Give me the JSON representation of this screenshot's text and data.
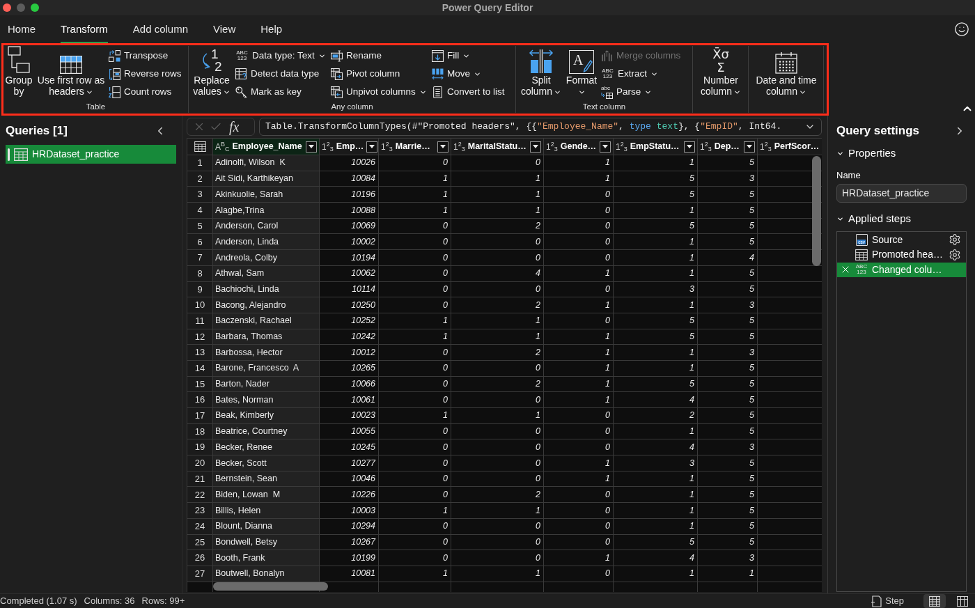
{
  "window": {
    "title": "Power Query Editor"
  },
  "menu_tabs": [
    {
      "label": "Home",
      "selected": false
    },
    {
      "label": "Transform",
      "selected": true
    },
    {
      "label": "Add column",
      "selected": false
    },
    {
      "label": "View",
      "selected": false
    },
    {
      "label": "Help",
      "selected": false
    }
  ],
  "ribbon": {
    "groups": [
      {
        "label": "Table",
        "columns": [
          {
            "kind": "large",
            "lines": [
              "Group",
              "by"
            ],
            "dropdown": false
          },
          {
            "kind": "large",
            "lines": [
              "Use first row as",
              "headers"
            ],
            "dropdown": true
          },
          {
            "kind": "stack",
            "items": [
              {
                "label": "Transpose",
                "dropdown": false,
                "disabled": false
              },
              {
                "label": "Reverse rows",
                "dropdown": false,
                "disabled": false
              },
              {
                "label": "Count rows",
                "dropdown": false,
                "disabled": false
              }
            ]
          }
        ]
      },
      {
        "label": "Any column",
        "columns": [
          {
            "kind": "large",
            "lines": [
              "Replace",
              "values"
            ],
            "dropdown": true,
            "icon_text": [
              "1",
              "2"
            ]
          },
          {
            "kind": "stack",
            "items": [
              {
                "label": "Data type: Text",
                "dropdown": true,
                "disabled": false,
                "icon_text": [
                  "ABC",
                  "123"
                ]
              },
              {
                "label": "Detect data type",
                "dropdown": false,
                "disabled": false
              },
              {
                "label": "Mark as key",
                "dropdown": false,
                "disabled": false
              }
            ]
          },
          {
            "kind": "stack",
            "items": [
              {
                "label": "Rename",
                "dropdown": false,
                "disabled": false
              },
              {
                "label": "Pivot column",
                "dropdown": false,
                "disabled": false
              },
              {
                "label": "Unpivot columns",
                "dropdown": true,
                "disabled": false
              }
            ]
          },
          {
            "kind": "stack",
            "items": [
              {
                "label": "Fill",
                "dropdown": true,
                "disabled": false
              },
              {
                "label": "Move",
                "dropdown": true,
                "disabled": false
              },
              {
                "label": "Convert to list",
                "dropdown": false,
                "disabled": false
              }
            ]
          }
        ]
      },
      {
        "label": "Text column",
        "columns": [
          {
            "kind": "large",
            "lines": [
              "Split",
              "column"
            ],
            "dropdown": true
          },
          {
            "kind": "large",
            "lines": [
              "Format"
            ],
            "dropdown": true,
            "icon_text": [
              "A"
            ]
          },
          {
            "kind": "stack",
            "items": [
              {
                "label": "Merge columns",
                "dropdown": false,
                "disabled": true
              },
              {
                "label": "Extract",
                "dropdown": true,
                "disabled": false,
                "icon_text": [
                  "ABC",
                  "123"
                ]
              },
              {
                "label": "Parse",
                "dropdown": true,
                "disabled": false,
                "icon_text": [
                  "abc"
                ]
              }
            ]
          }
        ]
      },
      {
        "columns": [
          {
            "kind": "large",
            "lines": [
              "Number",
              "column"
            ],
            "dropdown": true,
            "icon_text": [
              "X̄σ",
              "Σ"
            ]
          }
        ]
      },
      {
        "columns": [
          {
            "kind": "large",
            "lines": [
              "Date and time",
              "column"
            ],
            "dropdown": true
          }
        ]
      }
    ]
  },
  "queries": {
    "title": "Queries [1]",
    "items": [
      {
        "name": "HRDataset_practice",
        "selected": true
      }
    ]
  },
  "formula_bar": {
    "fx": "fx",
    "tokens": [
      {
        "text": "Table.TransformColumnTypes(#\"Promoted headers\", {{",
        "kind": "plain"
      },
      {
        "text": "\"Employee_Name\"",
        "kind": "string"
      },
      {
        "text": ", ",
        "kind": "plain"
      },
      {
        "text": "type",
        "kind": "keyword"
      },
      {
        "text": " text",
        "kind": "type"
      },
      {
        "text": "}, {",
        "kind": "plain"
      },
      {
        "text": "\"EmpID\"",
        "kind": "string"
      },
      {
        "text": ", Int64.",
        "kind": "plain"
      }
    ]
  },
  "table": {
    "columns": [
      {
        "name": "Employee_Name",
        "type_label": "A$^{B}$$_{C}$",
        "kind": "text",
        "selected": true
      },
      {
        "name": "Emp…",
        "type_label": "1$^{2}$$_{3}$",
        "kind": "number",
        "selected": false
      },
      {
        "name": "Marrie…",
        "type_label": "1$^{2}$$_{3}$",
        "kind": "number",
        "selected": false
      },
      {
        "name": "MaritalStatu…",
        "type_label": "1$^{2}$$_{3}$",
        "kind": "number",
        "selected": false
      },
      {
        "name": "Gende…",
        "type_label": "1$^{2}$$_{3}$",
        "kind": "number",
        "selected": false
      },
      {
        "name": "EmpStatu…",
        "type_label": "1$^{2}$$_{3}$",
        "kind": "number",
        "selected": false
      },
      {
        "name": "Dep…",
        "type_label": "1$^{2}$$_{3}$",
        "kind": "number",
        "selected": false
      },
      {
        "name": "PerfScor…",
        "type_label": "1$^{2}$$_{3}$",
        "kind": "number",
        "selected": false
      }
    ],
    "rows": [
      {
        "number": "1",
        "cells": [
          "Adinolfi, Wilson  K",
          "10026",
          "0",
          "0",
          "1",
          "1",
          "5"
        ]
      },
      {
        "number": "2",
        "cells": [
          "Ait Sidi, Karthikeyan",
          "10084",
          "1",
          "1",
          "1",
          "5",
          "3"
        ]
      },
      {
        "number": "3",
        "cells": [
          "Akinkuolie, Sarah",
          "10196",
          "1",
          "1",
          "0",
          "5",
          "5"
        ]
      },
      {
        "number": "4",
        "cells": [
          "Alagbe,Trina",
          "10088",
          "1",
          "1",
          "0",
          "1",
          "5"
        ]
      },
      {
        "number": "5",
        "cells": [
          "Anderson, Carol",
          "10069",
          "0",
          "2",
          "0",
          "5",
          "5"
        ]
      },
      {
        "number": "6",
        "cells": [
          "Anderson, Linda",
          "10002",
          "0",
          "0",
          "0",
          "1",
          "5"
        ]
      },
      {
        "number": "7",
        "cells": [
          "Andreola, Colby",
          "10194",
          "0",
          "0",
          "0",
          "1",
          "4"
        ]
      },
      {
        "number": "8",
        "cells": [
          "Athwal, Sam",
          "10062",
          "0",
          "4",
          "1",
          "1",
          "5"
        ]
      },
      {
        "number": "9",
        "cells": [
          "Bachiochi, Linda",
          "10114",
          "0",
          "0",
          "0",
          "3",
          "5"
        ]
      },
      {
        "number": "10",
        "cells": [
          "Bacong, Alejandro",
          "10250",
          "0",
          "2",
          "1",
          "1",
          "3"
        ]
      },
      {
        "number": "11",
        "cells": [
          "Baczenski, Rachael",
          "10252",
          "1",
          "1",
          "0",
          "5",
          "5"
        ]
      },
      {
        "number": "12",
        "cells": [
          "Barbara, Thomas",
          "10242",
          "1",
          "1",
          "1",
          "5",
          "5"
        ]
      },
      {
        "number": "13",
        "cells": [
          "Barbossa, Hector",
          "10012",
          "0",
          "2",
          "1",
          "1",
          "3"
        ]
      },
      {
        "number": "14",
        "cells": [
          "Barone, Francesco  A",
          "10265",
          "0",
          "0",
          "1",
          "1",
          "5"
        ]
      },
      {
        "number": "15",
        "cells": [
          "Barton, Nader",
          "10066",
          "0",
          "2",
          "1",
          "5",
          "5"
        ]
      },
      {
        "number": "16",
        "cells": [
          "Bates, Norman",
          "10061",
          "0",
          "0",
          "1",
          "4",
          "5"
        ]
      },
      {
        "number": "17",
        "cells": [
          "Beak, Kimberly",
          "10023",
          "1",
          "1",
          "0",
          "2",
          "5"
        ]
      },
      {
        "number": "18",
        "cells": [
          "Beatrice, Courtney",
          "10055",
          "0",
          "0",
          "0",
          "1",
          "5"
        ]
      },
      {
        "number": "19",
        "cells": [
          "Becker, Renee",
          "10245",
          "0",
          "0",
          "0",
          "4",
          "3"
        ]
      },
      {
        "number": "20",
        "cells": [
          "Becker, Scott",
          "10277",
          "0",
          "0",
          "1",
          "3",
          "5"
        ]
      },
      {
        "number": "21",
        "cells": [
          "Bernstein, Sean",
          "10046",
          "0",
          "0",
          "1",
          "1",
          "5"
        ]
      },
      {
        "number": "22",
        "cells": [
          "Biden, Lowan  M",
          "10226",
          "0",
          "2",
          "0",
          "1",
          "5"
        ]
      },
      {
        "number": "23",
        "cells": [
          "Billis, Helen",
          "10003",
          "1",
          "1",
          "0",
          "1",
          "5"
        ]
      },
      {
        "number": "24",
        "cells": [
          "Blount, Dianna",
          "10294",
          "0",
          "0",
          "0",
          "1",
          "5"
        ]
      },
      {
        "number": "25",
        "cells": [
          "Bondwell, Betsy",
          "10267",
          "0",
          "0",
          "0",
          "5",
          "5"
        ]
      },
      {
        "number": "26",
        "cells": [
          "Booth, Frank",
          "10199",
          "0",
          "0",
          "1",
          "4",
          "3"
        ]
      },
      {
        "number": "27",
        "cells": [
          "Boutwell, Bonalyn",
          "10081",
          "1",
          "1",
          "0",
          "1",
          "1"
        ]
      }
    ]
  },
  "query_settings": {
    "title": "Query settings",
    "properties": {
      "label": "Properties",
      "expanded": true,
      "name_label": "Name",
      "name_value": "HRDataset_practice"
    },
    "applied_steps": {
      "label": "Applied steps",
      "expanded": true,
      "steps": [
        {
          "name": "Source",
          "selected": false,
          "icon_text": [
            "csv"
          ]
        },
        {
          "name": "Promoted hea…",
          "selected": false
        },
        {
          "name": "Changed colu…",
          "selected": true,
          "icon_text": [
            "ABC",
            "123"
          ]
        }
      ]
    }
  },
  "status_bar": {
    "status": "Completed (1.07 s)",
    "columns": "Columns: 36",
    "rows": "Rows: 99+",
    "step_button": "Step",
    "views": [
      {
        "selected": true
      },
      {
        "selected": false
      }
    ]
  }
}
